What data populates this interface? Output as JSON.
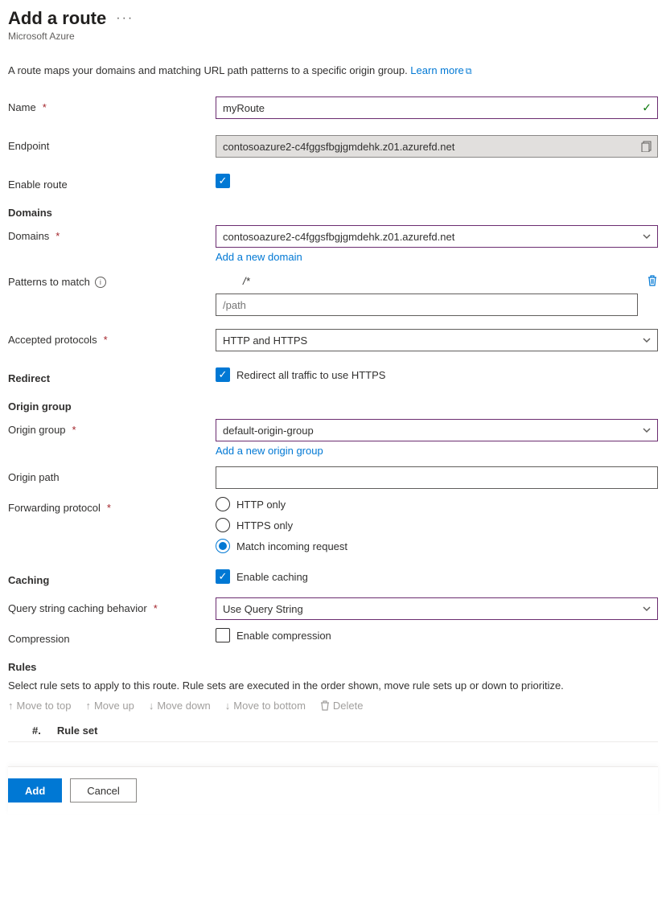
{
  "header": {
    "title": "Add a route",
    "subtitle": "Microsoft Azure"
  },
  "intro": {
    "text": "A route maps your domains and matching URL path patterns to a specific origin group. ",
    "link": "Learn more"
  },
  "fields": {
    "name": {
      "label": "Name",
      "value": "myRoute"
    },
    "endpoint": {
      "label": "Endpoint",
      "value": "contosoazure2-c4fggsfbgjgmdehk.z01.azurefd.net"
    },
    "enable_route": {
      "label": "Enable route"
    }
  },
  "domains": {
    "heading": "Domains",
    "label": "Domains",
    "selected": "contosoazure2-c4fggsfbgjgmdehk.z01.azurefd.net",
    "add_link": "Add a new domain",
    "patterns_label": "Patterns to match",
    "pattern_value": "/*",
    "pattern_placeholder": "/path",
    "protocols_label": "Accepted protocols",
    "protocols_value": "HTTP and HTTPS"
  },
  "redirect": {
    "heading": "Redirect",
    "label": "Redirect all traffic to use HTTPS"
  },
  "origin": {
    "heading": "Origin group",
    "group_label": "Origin group",
    "group_value": "default-origin-group",
    "add_link": "Add a new origin group",
    "path_label": "Origin path",
    "path_value": "",
    "fwd_label": "Forwarding protocol",
    "fwd_options": {
      "http": "HTTP only",
      "https": "HTTPS only",
      "match": "Match incoming request"
    }
  },
  "caching": {
    "heading": "Caching",
    "enable_label": "Enable caching",
    "qs_label": "Query string caching behavior",
    "qs_value": "Use Query String",
    "compression_label": "Compression",
    "compression_cb": "Enable compression"
  },
  "rules": {
    "heading": "Rules",
    "desc": "Select rule sets to apply to this route. Rule sets are executed in the order shown, move rule sets up or down to prioritize.",
    "toolbar": {
      "top": "Move to top",
      "up": "Move up",
      "down": "Move down",
      "bottom": "Move to bottom",
      "delete": "Delete"
    },
    "cols": {
      "num": "#.",
      "set": "Rule set"
    }
  },
  "footer": {
    "add": "Add",
    "cancel": "Cancel"
  }
}
